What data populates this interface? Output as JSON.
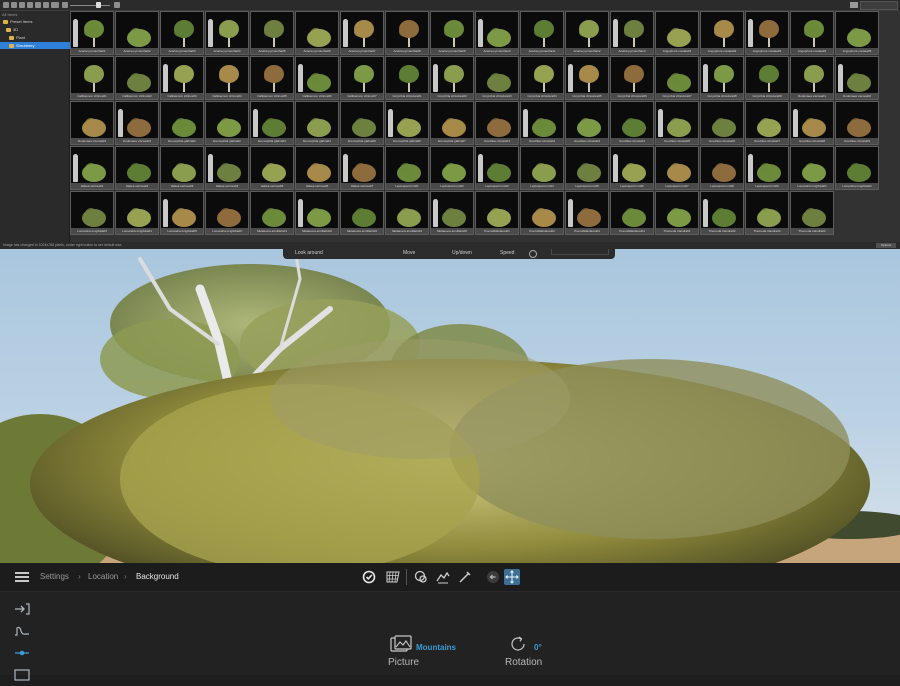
{
  "library": {
    "tree": {
      "header": "All Items",
      "items": [
        {
          "label": "Preset Items",
          "selected": false
        },
        {
          "label": "3D",
          "selected": false
        },
        {
          "label": "Plant",
          "selected": false
        },
        {
          "label": "Shrubbery",
          "selected": true
        }
      ]
    },
    "rows": [
      [
        "Acacia pycnantha01",
        "Acacia pycnantha02",
        "Acacia pycnantha03",
        "Acacia pycnantha04",
        "Acacia pycnantha05",
        "Acacia pycnantha06",
        "Acacia pycnantha07",
        "Acacia pycnantha08",
        "Acacia pycnantha09",
        "Acacia pycnantha10",
        "Acacia pycnantha11",
        "Acacia pycnantha12",
        "Acacia pycnantha13",
        "Angophora costata01",
        "Angophora costata02",
        "Angophora costata03",
        "Angophora costata04",
        "Angophora costata05"
      ],
      [
        "Callistemon citrinus01",
        "Callistemon citrinus02",
        "Callistemon citrinus03",
        "Callistemon citrinus04",
        "Callistemon citrinus05",
        "Callistemon citrinus06",
        "Callistemon citrinus07",
        "Corymbia citriodora01",
        "Corymbia citriodora02",
        "Corymbia citriodora03",
        "Corymbia citriodora04",
        "Corymbia citriodora05",
        "Corymbia citriodora06",
        "Corymbia citriodora07",
        "Corymbia citriodora08",
        "Corymbia citriodora09",
        "Dodonaea viscosa01",
        "Dodonaea viscosa02"
      ],
      [
        "Dodonaea viscosa03",
        "Dodonaea viscosa04",
        "Eremophila glabra01",
        "Eremophila glabra02",
        "Eremophila glabra03",
        "Eremophila glabra04",
        "Eremophila glabra05",
        "Eremophila glabra06",
        "Eremophila glabra07",
        "Grevillea robusta01",
        "Grevillea robusta02",
        "Grevillea robusta03",
        "Grevillea robusta04",
        "Grevillea robusta05",
        "Grevillea robusta06",
        "Grevillea robusta07",
        "Grevillea robusta08",
        "Grevillea robusta09"
      ],
      [
        "Hakea sericea01",
        "Hakea sericea02",
        "Hakea sericea03",
        "Hakea sericea04",
        "Hakea sericea05",
        "Hakea sericea06",
        "Hakea sericea07",
        "Leptospermum01",
        "Leptospermum02",
        "Leptospermum03",
        "Leptospermum04",
        "Leptospermum05",
        "Leptospermum06",
        "Leptospermum07",
        "Leptospermum08",
        "Leptospermum09",
        "Lomandra longifolia01",
        "Lomandra longifolia02"
      ],
      [
        "Lomandra longifolia03",
        "Lomandra longifolia04",
        "Lomandra longifolia05",
        "Lomandra longifolia06",
        "Melaleuca armillaris01",
        "Melaleuca armillaris02",
        "Melaleuca armillaris03",
        "Melaleuca armillaris04",
        "Melaleuca armillaris05",
        "Poa labillardierei01",
        "Poa labillardierei02",
        "Poa labillardierei03",
        "Poa labillardierei04",
        "Themeda triandra01",
        "Themeda triandra02",
        "Themeda triandra03",
        "Themeda triandra04"
      ]
    ],
    "status": "Image has changed to 1024x768 pixels, under right button to set default size.",
    "options_button": "Options"
  },
  "viewport": {
    "nav_hints": [
      "Look around",
      "Move",
      "Up/down",
      "Speed"
    ]
  },
  "toolbar": {
    "breadcrumb": [
      "Settings",
      "Location",
      "Background"
    ]
  },
  "properties": {
    "picture": {
      "label": "Picture",
      "value": "Mountains"
    },
    "rotation": {
      "label": "Rotation",
      "value": "0°"
    }
  },
  "colors": {
    "accent": "#3b9bd6",
    "selection": "#2d7fd8",
    "folder": "#e0b24a"
  }
}
